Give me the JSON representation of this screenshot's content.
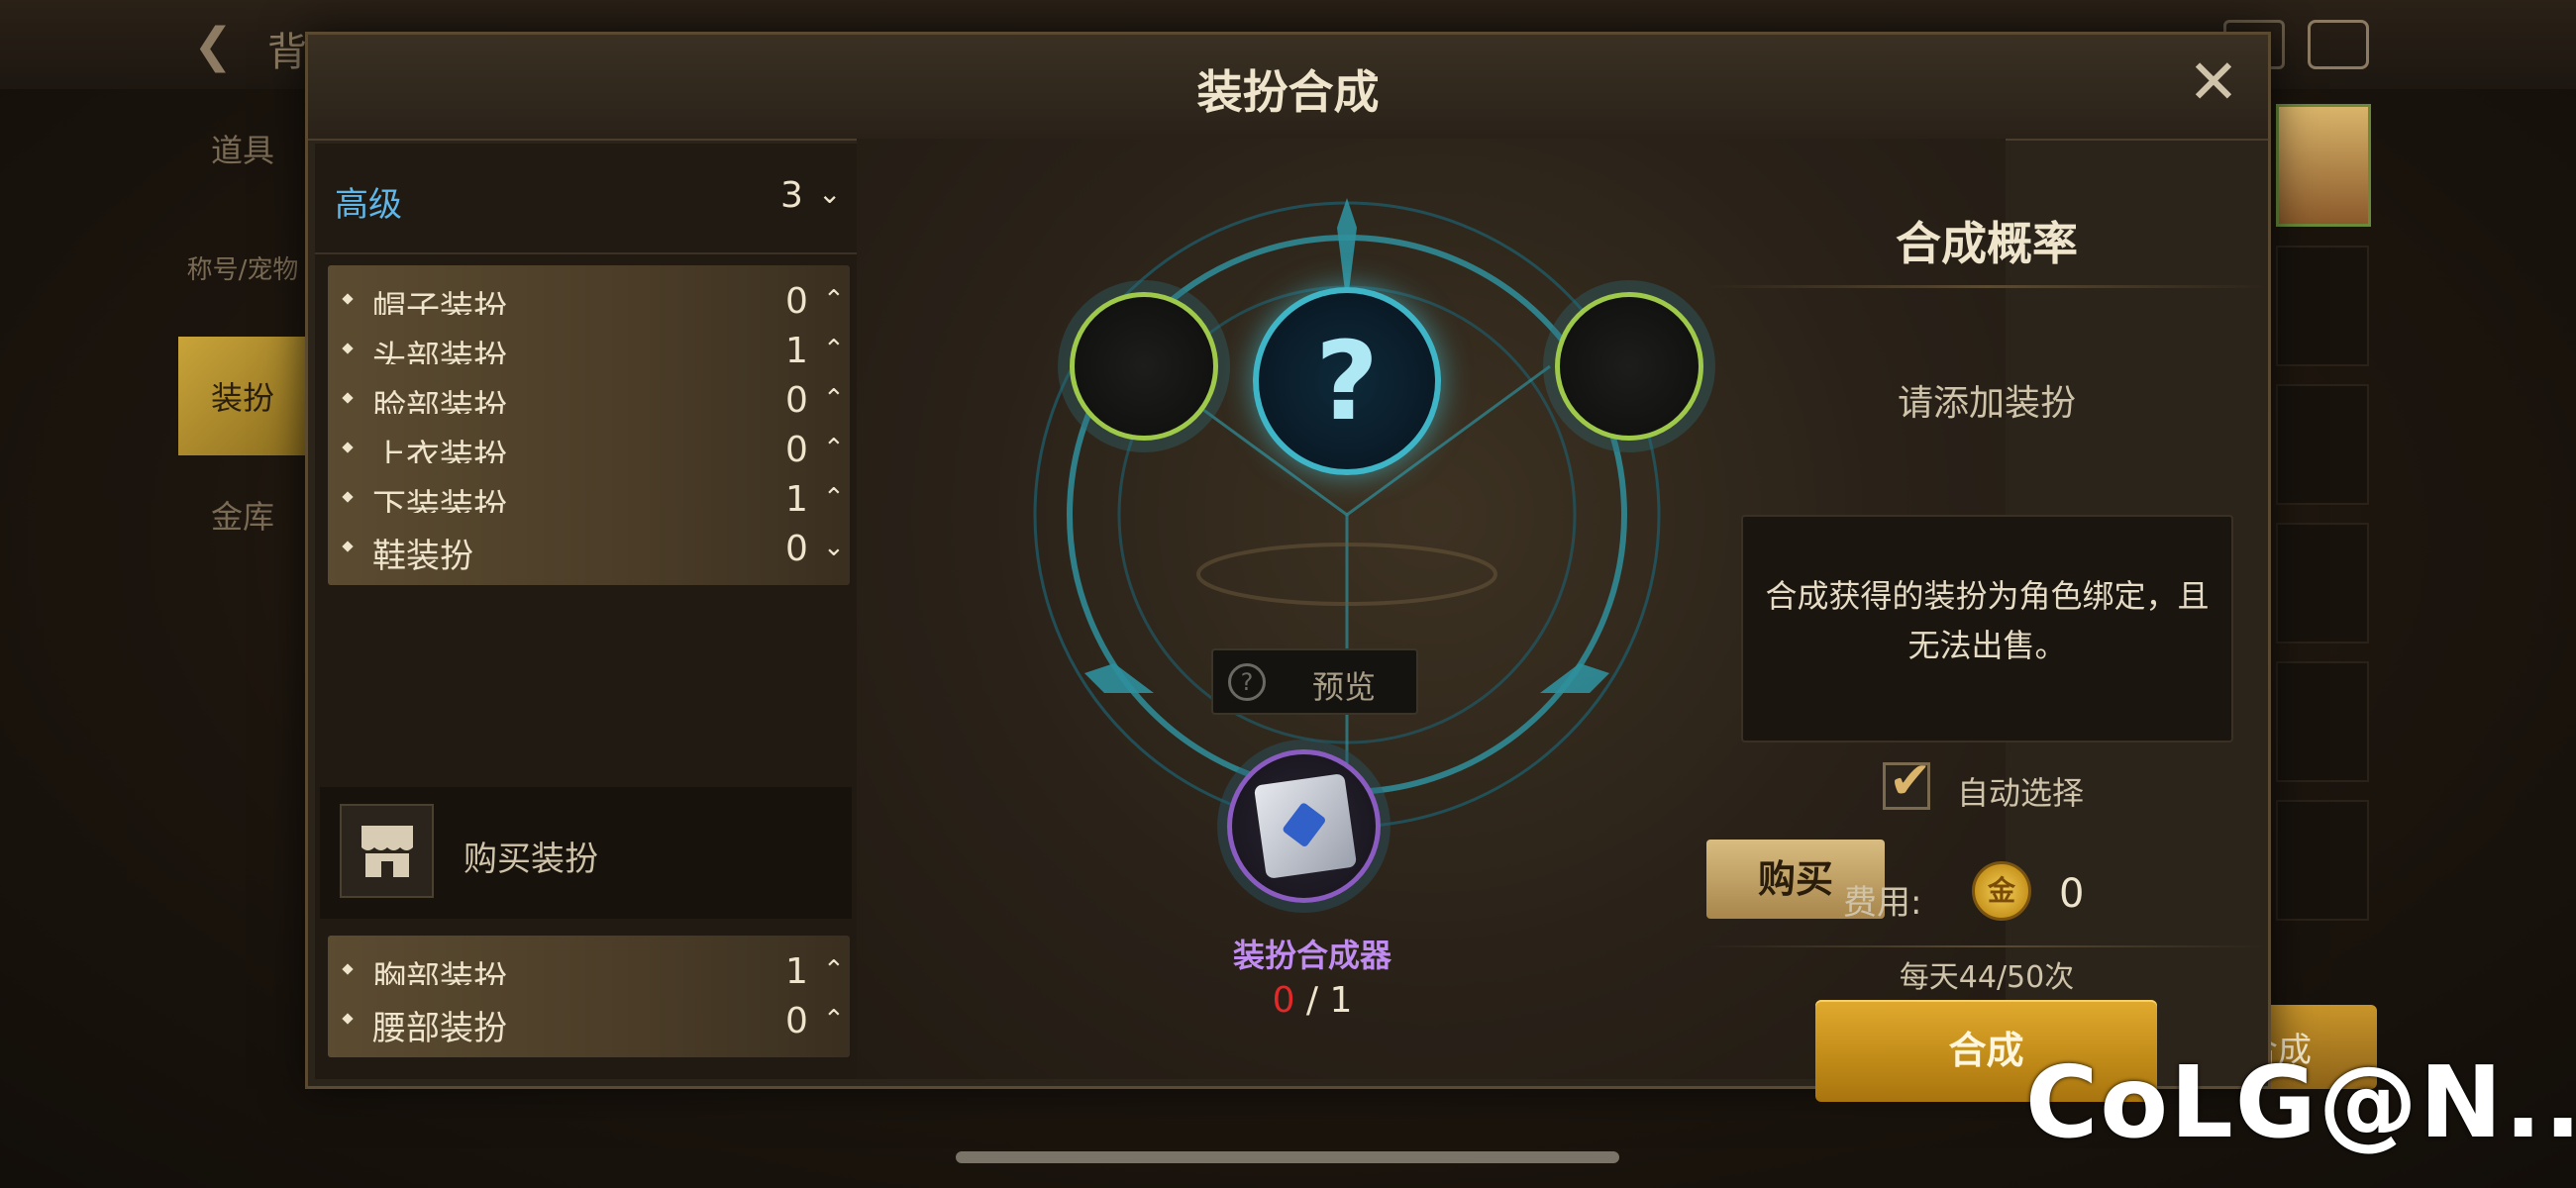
{
  "background": {
    "nav_title": "背包",
    "side_tabs": [
      "道具",
      "称号/宠物",
      "装扮",
      "金库"
    ],
    "bottom_button": "合成"
  },
  "modal": {
    "title": "装扮合成",
    "close_icon": "close-icon",
    "grade": {
      "name": "高级",
      "count": "3"
    },
    "categories": [
      {
        "label": "帽子装扮",
        "count": "0",
        "chevron": "up"
      },
      {
        "label": "头部装扮",
        "count": "1",
        "chevron": "up"
      },
      {
        "label": "脸部装扮",
        "count": "0",
        "chevron": "up"
      },
      {
        "label": "上衣装扮",
        "count": "0",
        "chevron": "up"
      },
      {
        "label": "下装装扮",
        "count": "1",
        "chevron": "up"
      },
      {
        "label": "鞋装扮",
        "count": "0",
        "chevron": "down"
      }
    ],
    "buy_costume": "购买装扮",
    "categories_after": [
      {
        "label": "胸部装扮",
        "count": "1",
        "chevron": "up"
      },
      {
        "label": "腰部装扮",
        "count": "0",
        "chevron": "up"
      }
    ],
    "center": {
      "result_symbol": "?",
      "preview_label": "预览",
      "buy_label": "购买",
      "synthesizer_name": "装扮合成器",
      "synthesizer_have": "0",
      "synthesizer_sep": "/",
      "synthesizer_need": "1"
    },
    "right": {
      "title": "合成概率",
      "hint": "请添加装扮",
      "notice": "合成获得的装扮为角色绑定，且无法出售。",
      "auto_select_label": "自动选择",
      "auto_select_checked": true,
      "fee_label": "费用:",
      "coin_glyph": "金",
      "fee_value": "0",
      "daily_limit": "每天44/50次",
      "synthesize_label": "合成"
    }
  },
  "watermark": "CoLG@N....."
}
